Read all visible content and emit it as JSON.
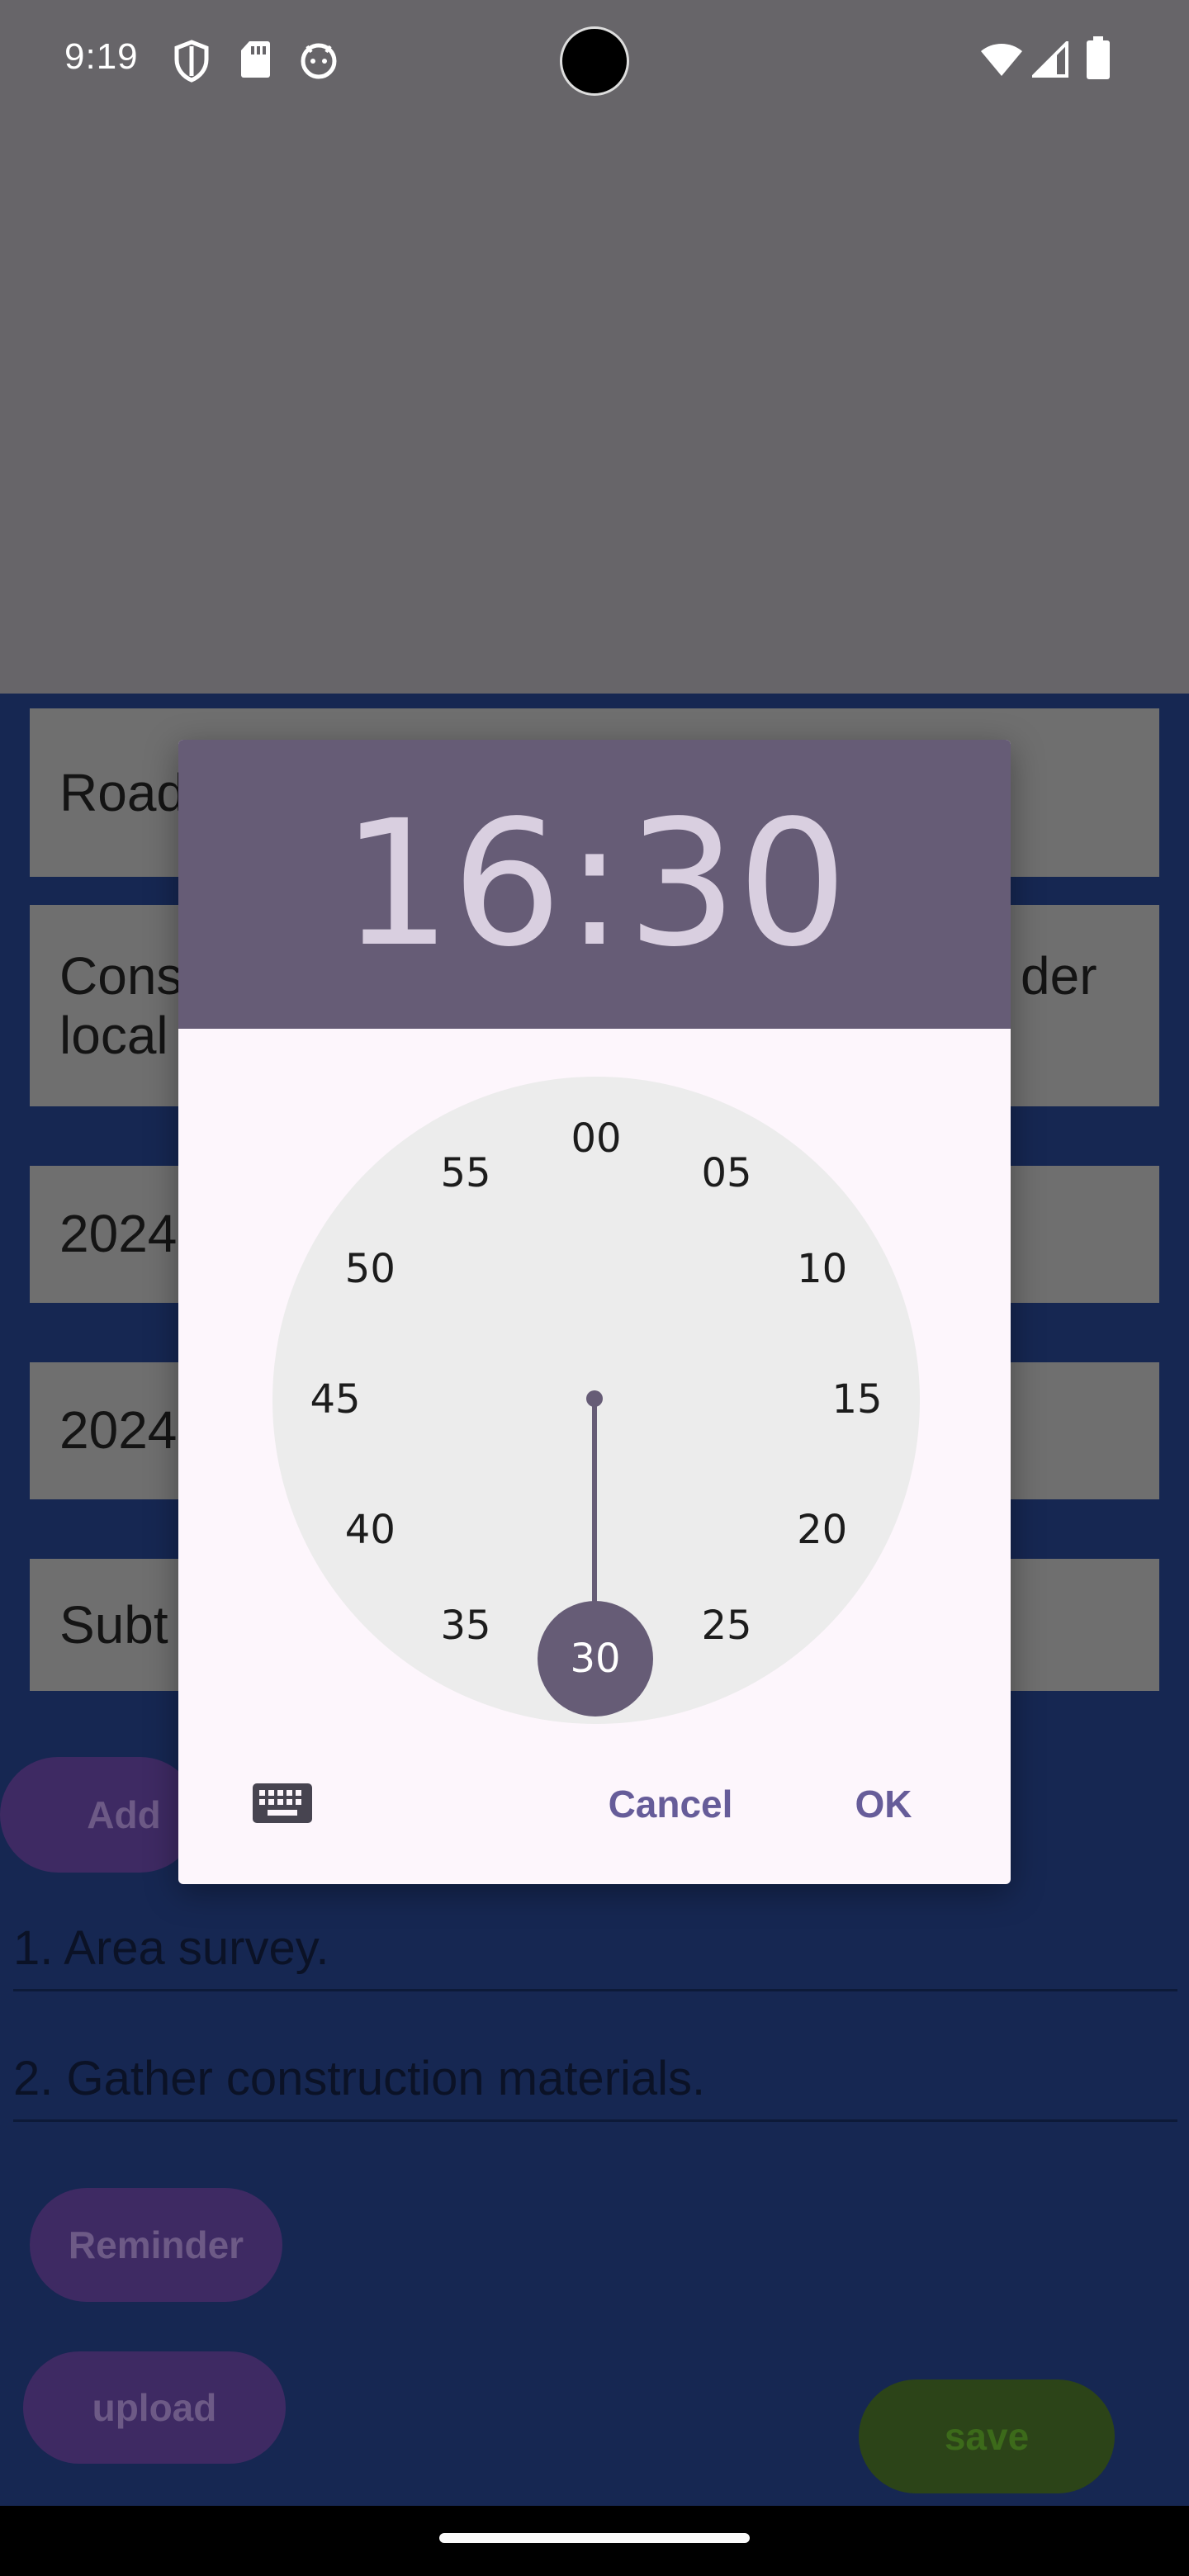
{
  "status_bar": {
    "time": "9:19",
    "icons": [
      "shield-icon",
      "sd-card-icon",
      "android-face-icon",
      "wifi-icon",
      "signal-icon",
      "battery-icon"
    ]
  },
  "app": {
    "fields": [
      {
        "text": "Road"
      },
      {
        "text_left_line1": "Cons",
        "text_left_line2": "local",
        "text_right": "der"
      },
      {
        "text": "2024"
      },
      {
        "text": "2024"
      },
      {
        "text": "Subt"
      }
    ],
    "add_button_label": "Add",
    "tasks": [
      "1. Area survey.",
      "2. Gather construction materials."
    ],
    "reminder_button_label": "Reminder",
    "upload_button_label": "upload",
    "save_button_label": "save"
  },
  "time_picker": {
    "hour": "16",
    "separator": ":",
    "minute": "30",
    "minute_labels": [
      "00",
      "05",
      "10",
      "15",
      "20",
      "25",
      "30",
      "35",
      "40",
      "45",
      "50",
      "55"
    ],
    "selected_minute": "30",
    "cancel_label": "Cancel",
    "ok_label": "OK",
    "keyboard_icon": "keyboard-icon"
  },
  "colors": {
    "header": "#665c76",
    "accent_text": "#665c99",
    "dialog_bg": "#fdf6fc",
    "clock_face": "#ececec",
    "app_bg": "#162752"
  }
}
